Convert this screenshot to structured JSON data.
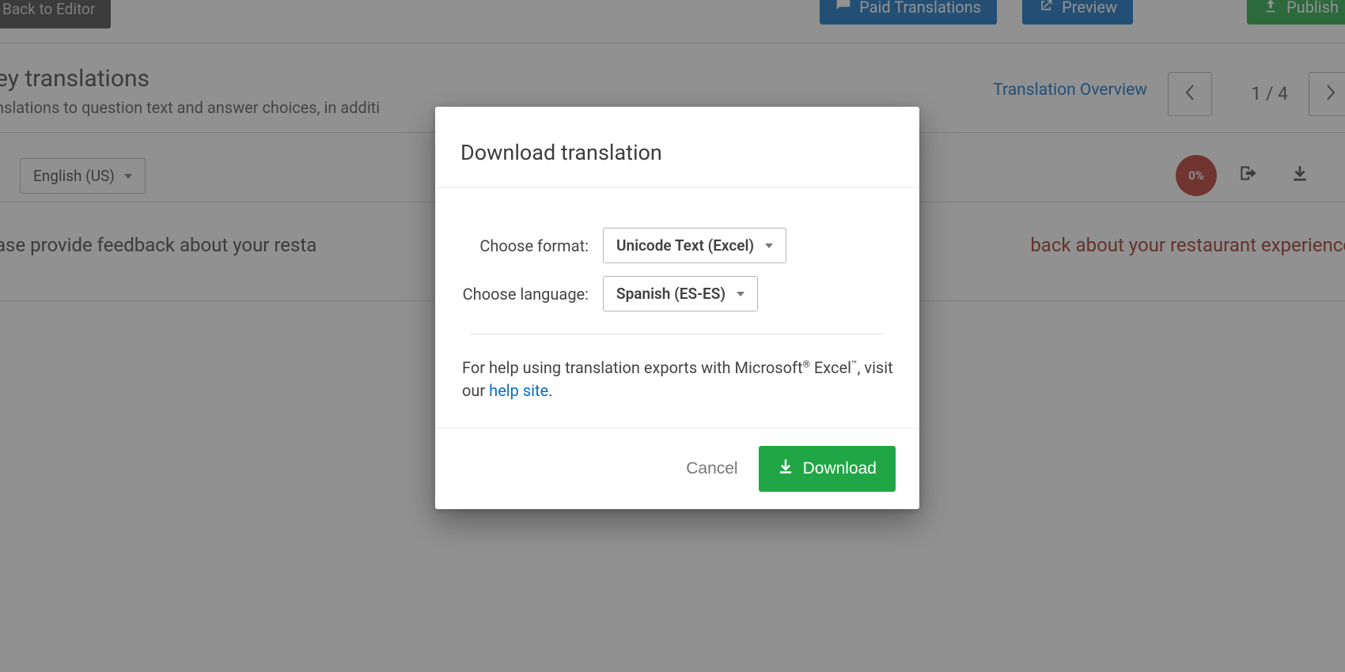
{
  "topbar": {
    "back_label": "Back to Editor",
    "paid_label": "Paid Translations",
    "preview_label": "Preview",
    "publish_label": "Publish"
  },
  "page": {
    "heading": "ey translations",
    "subheading": "nslations to question text and answer choices, in additi",
    "translation_overview": "Translation Overview",
    "pager_label": "1 / 4"
  },
  "toolbar": {
    "language_selected": "English (US)",
    "percent_badge": "0%"
  },
  "questions": {
    "left_text": "ase provide feedback about your resta",
    "right_text": "back about your restaurant experience"
  },
  "modal": {
    "title": "Download translation",
    "format_label": "Choose format:",
    "format_value": "Unicode Text (Excel)",
    "language_label": "Choose language:",
    "language_value": "Spanish (ES-ES)",
    "help_prefix": "For help using translation exports with Microsoft",
    "help_middle": " Excel",
    "help_visit": ", visit our ",
    "help_link": "help site",
    "help_period": ".",
    "cancel": "Cancel",
    "download": "Download"
  }
}
